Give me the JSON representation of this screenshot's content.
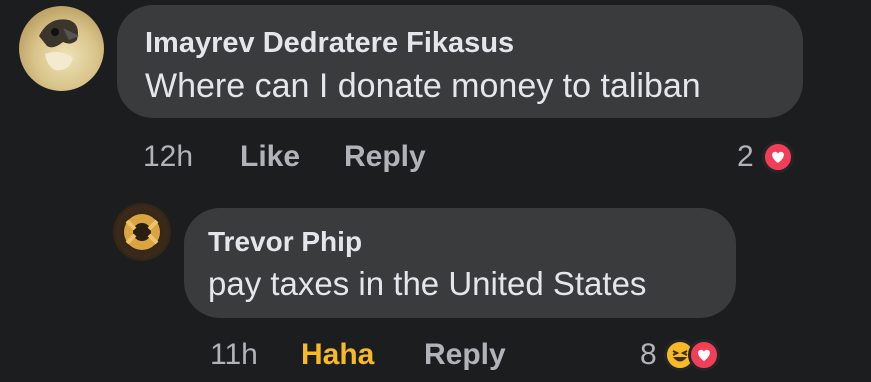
{
  "comments": [
    {
      "author": "Imayrev Dedratere Fikasus",
      "text": "Where can I donate money to taliban",
      "time": "12h",
      "actions": {
        "like": "Like",
        "reply": "Reply"
      },
      "reaction_count": "2",
      "reactions": [
        "love-icon"
      ]
    },
    {
      "author": "Trevor Phip",
      "text": "pay taxes in the United States",
      "time": "11h",
      "actions": {
        "like": "Haha",
        "reply": "Reply"
      },
      "reaction_count": "8",
      "reactions": [
        "haha-icon",
        "love-icon"
      ]
    }
  ],
  "colors": {
    "background": "#1c1d1f",
    "bubble": "#3a3b3c",
    "primary_text": "#e4e6eb",
    "secondary_text": "#b0b3b8",
    "haha_active": "#f7b928",
    "love": "#f33e58"
  }
}
